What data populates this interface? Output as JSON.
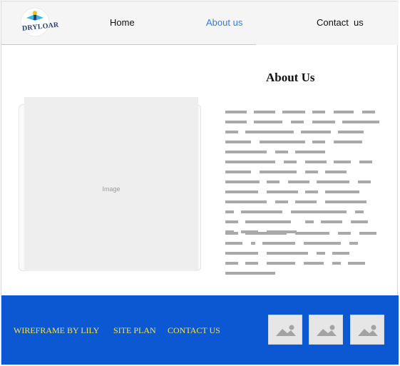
{
  "logo": {
    "text": "DRYLOAR"
  },
  "nav": {
    "home": "Home",
    "about": "About us",
    "contact": "Contact  us"
  },
  "main": {
    "title": "About Us",
    "image_label": "Image"
  },
  "footer": {
    "links": [
      "WIREFRAME BY LILY",
      "SITE PLAN",
      "CONTACT US"
    ],
    "thumbnails": [
      "image-icon",
      "image-icon",
      "image-icon"
    ]
  },
  "colors": {
    "header_bg": "#f5f5f5",
    "active_nav": "#2f7de1",
    "footer_bg": "#0c58d3",
    "footer_link": "#f3e34a",
    "placeholder": "#eeeeee",
    "text_placeholder": "#a9a9a9"
  }
}
